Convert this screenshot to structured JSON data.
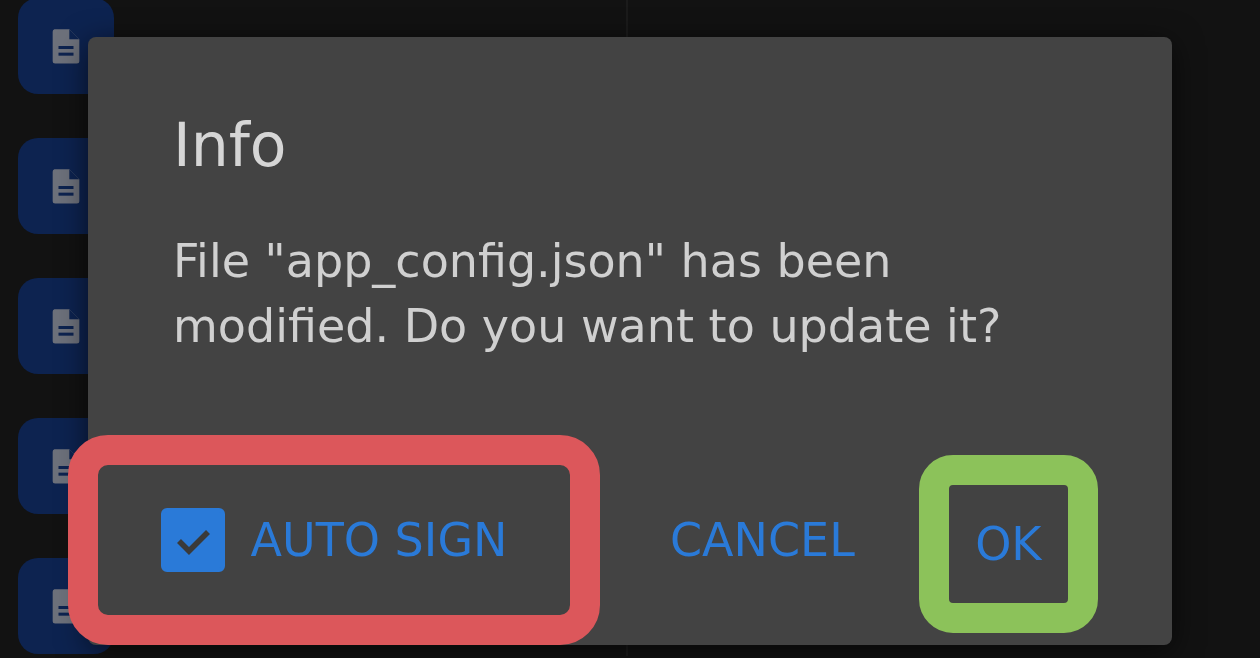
{
  "files": [
    {
      "kind": "file"
    },
    {
      "kind": "file"
    },
    {
      "kind": "file"
    },
    {
      "kind": "file"
    },
    {
      "kind": "file"
    }
  ],
  "dialog": {
    "title": "Info",
    "message": "File \"app_config.json\" has been modified. Do you want to update it?",
    "checkbox": {
      "label": "AUTO SIGN",
      "checked": true,
      "color": "#dc575b"
    },
    "buttons": [
      {
        "label": "CANCEL"
      },
      {
        "label": "OK",
        "color": "#8cc25a"
      }
    ]
  }
}
